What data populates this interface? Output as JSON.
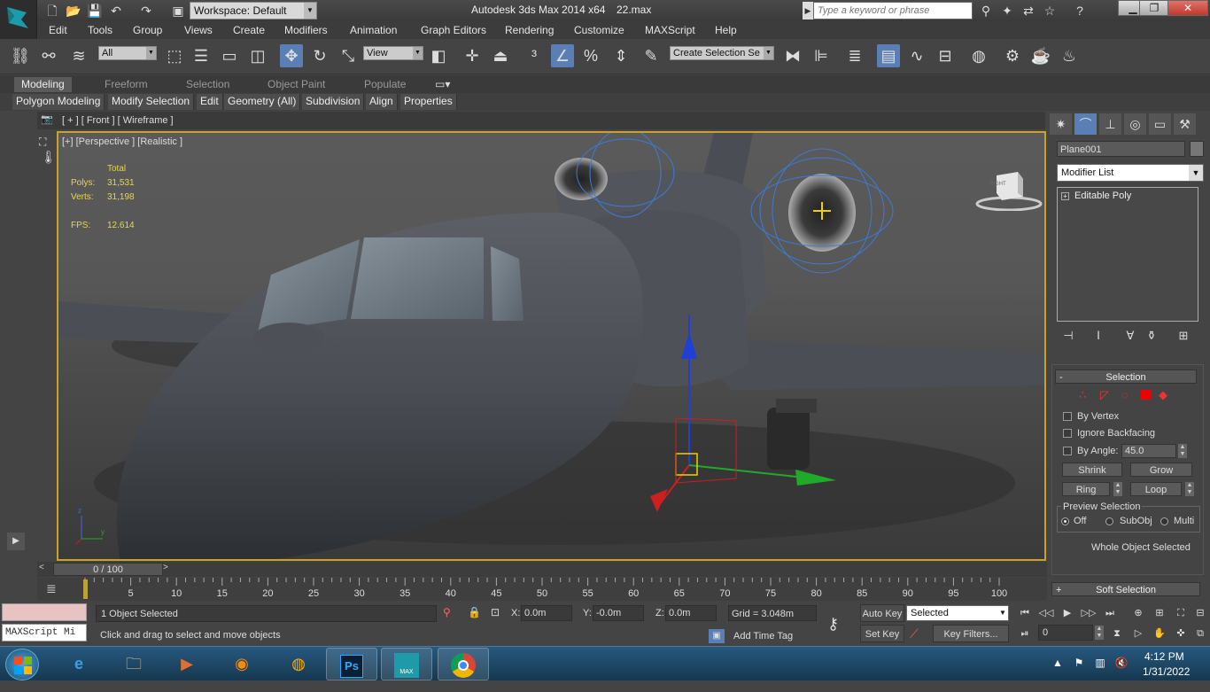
{
  "window": {
    "app_title": "Autodesk 3ds Max  2014 x64",
    "file_name": "22.max",
    "workspace": "Workspace: Default",
    "search_placeholder": "Type a keyword or phrase"
  },
  "menu": [
    "Edit",
    "Tools",
    "Group",
    "Views",
    "Create",
    "Modifiers",
    "Animation",
    "Graph Editors",
    "Rendering",
    "Customize",
    "MAXScript",
    "Help"
  ],
  "toolbar": {
    "selection_filter": "All",
    "ref_coord": "View",
    "named_selection_placeholder": "Create Selection Se"
  },
  "ribbon": {
    "tabs": [
      "Modeling",
      "Freeform",
      "Selection",
      "Object Paint",
      "Populate"
    ],
    "active_tab": "Modeling",
    "panels": [
      "Polygon Modeling",
      "Modify Selection",
      "Edit",
      "Geometry (All)",
      "Subdivision",
      "Align",
      "Properties"
    ]
  },
  "viewport": {
    "top_strip_label": "[ + ] [ Front ] [ Wireframe ]",
    "label": "[+] [Perspective ] [Realistic ]",
    "stats": {
      "header": "Total",
      "polys_label": "Polys:",
      "polys": "31,531",
      "verts_label": "Verts:",
      "verts": "31,198",
      "fps_label": "FPS:",
      "fps": "12.614"
    },
    "viewcube_label": "RIGHT"
  },
  "command_panel": {
    "object_name": "Plane001",
    "modifier_list": "Modifier List",
    "stack_item": "Editable Poly",
    "selection_rollout": {
      "title": "Selection",
      "by_vertex": "By Vertex",
      "ignore_backfacing": "Ignore Backfacing",
      "by_angle": "By Angle:",
      "angle_value": "45.0",
      "shrink": "Shrink",
      "grow": "Grow",
      "ring": "Ring",
      "loop": "Loop",
      "preview_title": "Preview Selection",
      "preview_off": "Off",
      "preview_subobj": "SubObj",
      "preview_multi": "Multi",
      "status": "Whole Object Selected"
    },
    "soft_selection": "Soft Selection"
  },
  "timeline": {
    "range": "0 / 100",
    "ticks": [
      "5",
      "10",
      "15",
      "20",
      "25",
      "30",
      "35",
      "40",
      "45",
      "50",
      "55",
      "60",
      "65",
      "70",
      "75",
      "80",
      "85",
      "90",
      "95",
      "100"
    ]
  },
  "status": {
    "maxscript_listener": "MAXScript Mi",
    "selection": "1 Object Selected",
    "prompt": "Click and drag to select and move objects",
    "x_label": "X:",
    "x": "0.0m",
    "y_label": "Y:",
    "y": "-0.0m",
    "z_label": "Z:",
    "z": "0.0m",
    "grid": "Grid = 3.048m",
    "add_time_tag": "Add Time Tag",
    "auto_key": "Auto Key",
    "set_key": "Set Key",
    "key_mode": "Selected",
    "key_filters": "Key Filters...",
    "frame": "0"
  },
  "taskbar": {
    "time": "4:12 PM",
    "date": "1/31/2022",
    "max_label": "MAX"
  }
}
